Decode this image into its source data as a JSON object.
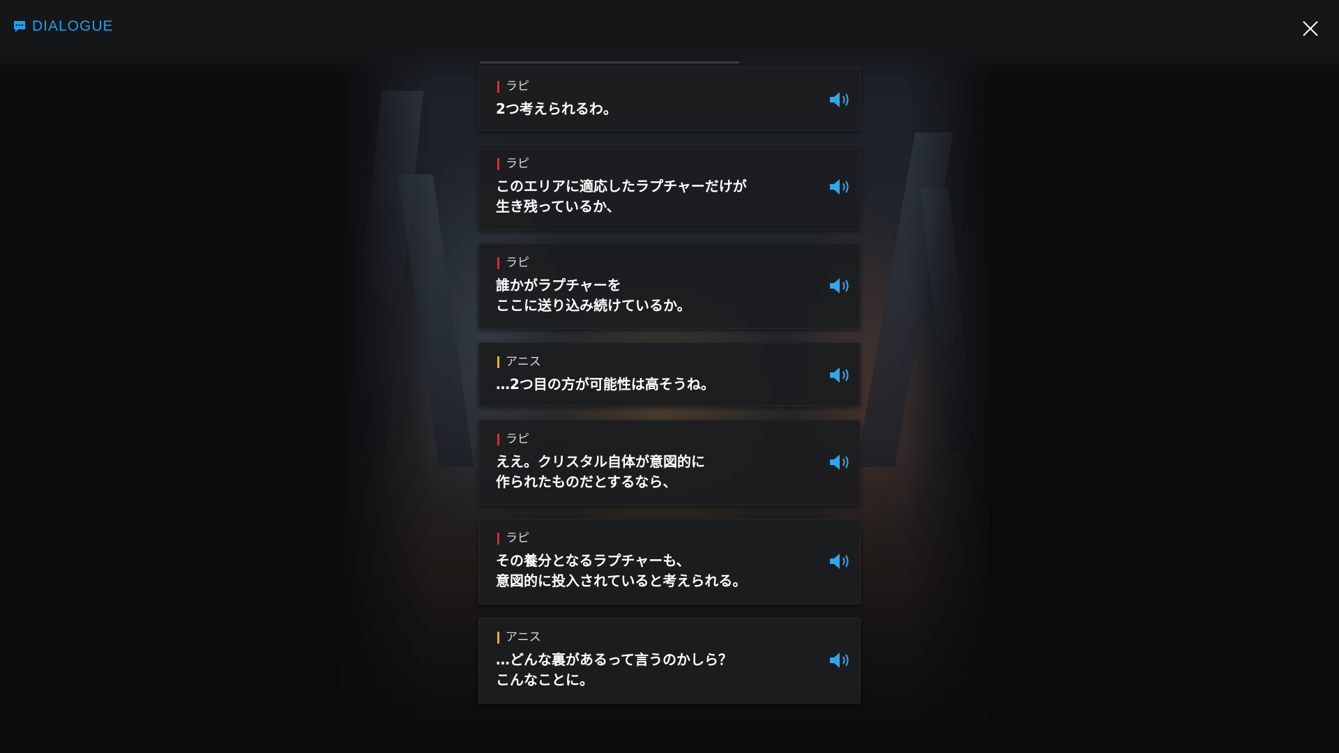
{
  "header": {
    "title": "DIALOGUE",
    "title_color": "#1aa0ee",
    "icons": {
      "title": "chat-bubble-icon",
      "close": "close-icon"
    }
  },
  "colors": {
    "speaker_red": "#e02a2a",
    "speaker_yellow": "#f0b01e",
    "voice": "#2fa6ee"
  },
  "dialogue": [
    {
      "speaker": "ラピ",
      "bar": "red",
      "text": "2つ考えられるわ。",
      "voice_icon": "speaker-icon"
    },
    {
      "speaker": "ラピ",
      "bar": "red",
      "text": "このエリアに適応したラプチャーだけが\n生き残っているか、",
      "voice_icon": "speaker-icon"
    },
    {
      "speaker": "ラピ",
      "bar": "red",
      "text": "誰かがラプチャーを\nここに送り込み続けているか。",
      "voice_icon": "speaker-icon"
    },
    {
      "speaker": "アニス",
      "bar": "yellow",
      "text": "…2つ目の方が可能性は高そうね。",
      "voice_icon": "speaker-icon"
    },
    {
      "speaker": "ラピ",
      "bar": "red",
      "text": "ええ。クリスタル自体が意図的に\n作られたものだとするなら、",
      "voice_icon": "speaker-icon"
    },
    {
      "speaker": "ラピ",
      "bar": "red",
      "text": "その養分となるラプチャーも、\n意図的に投入されていると考えられる。",
      "voice_icon": "speaker-icon"
    },
    {
      "speaker": "アニス",
      "bar": "yellow",
      "text": "…どんな裏があるって言うのかしら？\nこんなことに。",
      "voice_icon": "speaker-icon"
    }
  ]
}
